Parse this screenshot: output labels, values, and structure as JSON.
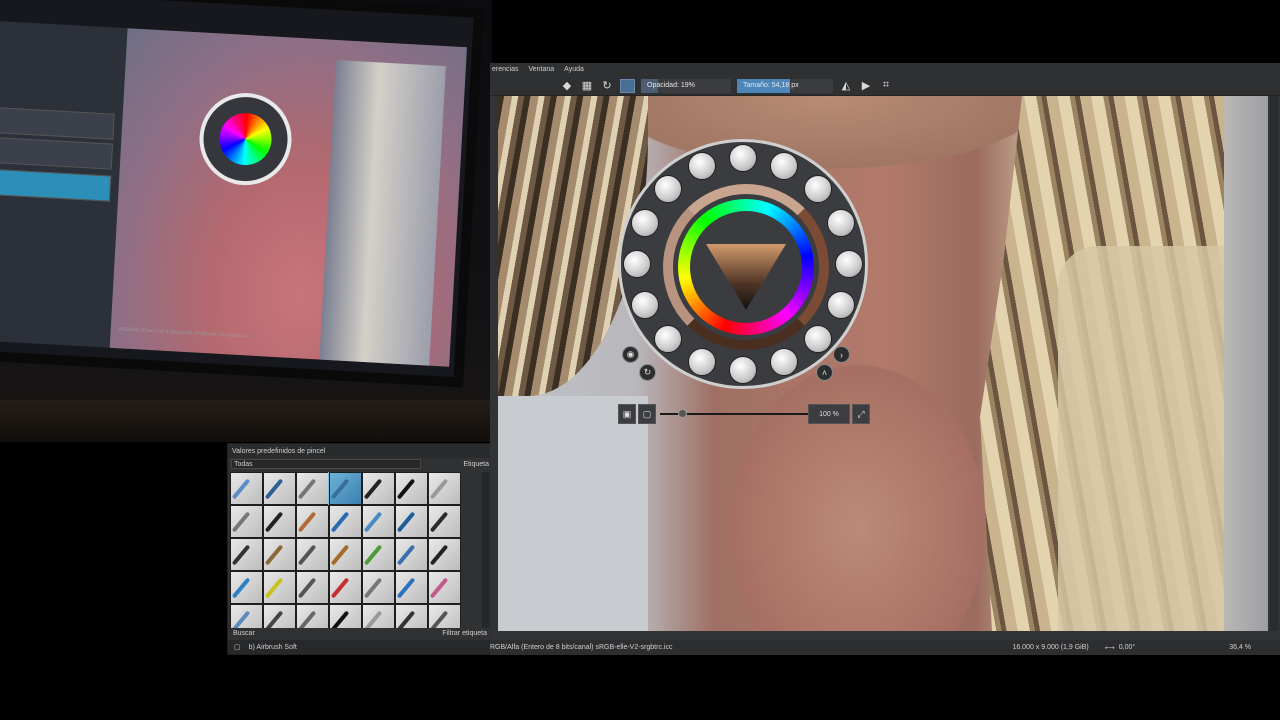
{
  "presets_docker": {
    "title": "Valores predefinidos de pincel",
    "filter_value": "Todas",
    "tag_label": "Etiqueta",
    "search_placeholder": "Buscar",
    "filter_tag_label": "Filtrar etiqueta",
    "current_brush": "b) Airbrush Soft",
    "brushes": [
      "#5b8cc9",
      "#2f5f96",
      "#777",
      "#3a6d9a",
      "#222",
      "#111",
      "#999",
      "#777",
      "#222",
      "#b36a3a",
      "#2b6bb0",
      "#4a89c2",
      "#1e5e9e",
      "#2b2b2b",
      "#333",
      "#8a6a3a",
      "#555",
      "#a36b2a",
      "#4f9b3a",
      "#3b6fb0",
      "#222",
      "#2e7fc4",
      "#c9c21a",
      "#555",
      "#c43030",
      "#777",
      "#2a72c0",
      "#c45a8a",
      "#5b8ac0",
      "#444",
      "#666",
      "#111",
      "#999",
      "#333",
      "#555"
    ]
  },
  "photo": {
    "monitor_caption": "RGB/Alfa (Entero de 8 bits/canal)  sRGB-elle-V2-srgbtrc.icc"
  },
  "krita": {
    "menu": [
      "erencias",
      "Ventana",
      "Ayuda"
    ],
    "opacity_label": "Opacidad: 19%",
    "size_label": "Tamaño: 54,18 px",
    "zoom_label": "100 %",
    "status": {
      "color_space": "RGB/Alfa (Entero de 8 bits/canal)  sRGB-elle-V2-srgbtrc.icc",
      "dimensions": "16.000 x 9.000 (1,9 GiB)",
      "rotation": "0,00°",
      "zoom": "36,4 %"
    }
  }
}
